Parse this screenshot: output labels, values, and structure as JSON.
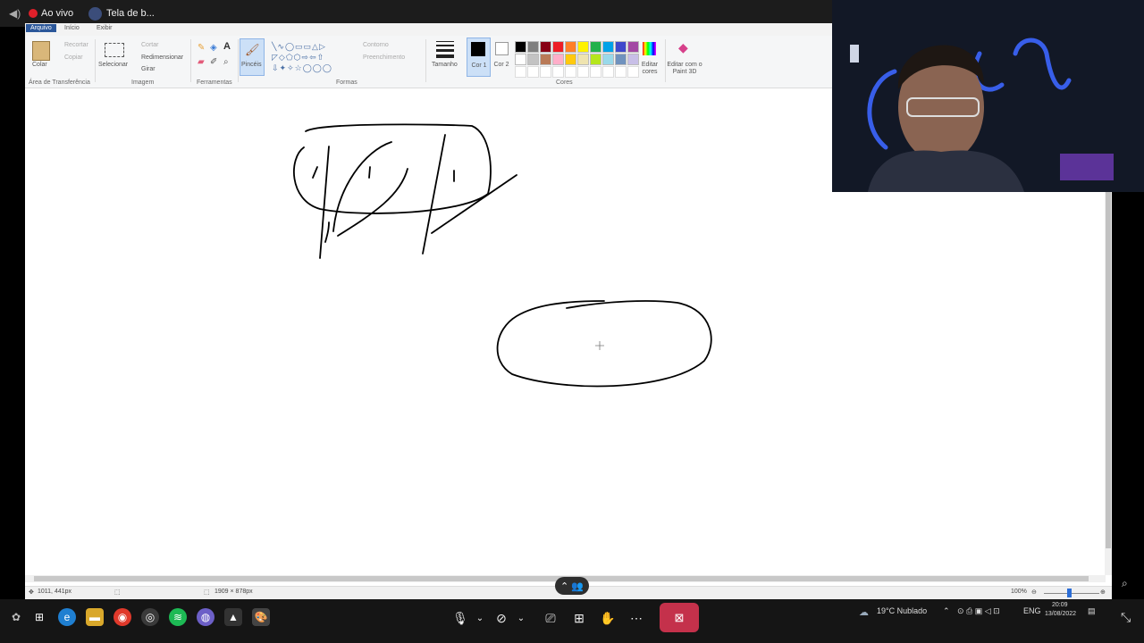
{
  "meeting": {
    "live_label": "Ao vivo",
    "share_label": "Tela de b..."
  },
  "paint": {
    "menus": [
      "Arquivo",
      "Início",
      "Exibir"
    ],
    "clipboard": {
      "paste": "Colar",
      "cut": "Recortar",
      "copy": "Copiar",
      "group": "Área de Transferência"
    },
    "image": {
      "select": "Selecionar",
      "crop": "Cortar",
      "resize": "Redimensionar",
      "rotate": "Girar",
      "group": "Imagem"
    },
    "tools": {
      "group": "Ferramentas"
    },
    "brushes": "Pincéis",
    "shapes": {
      "outline": "Contorno",
      "fill": "Preenchimento",
      "group": "Formas"
    },
    "size": "Tamanho",
    "color1": "Cor 1",
    "color2": "Cor 2",
    "colors_group": "Cores",
    "edit_colors": "Editar cores",
    "edit_paint3d": "Editar com o Paint 3D",
    "palette_row1": [
      "#000000",
      "#7f7f7f",
      "#880015",
      "#ed1c24",
      "#ff7f27",
      "#fff200",
      "#22b14c",
      "#00a2e8",
      "#3f48cc",
      "#a349a4"
    ],
    "palette_row2": [
      "#ffffff",
      "#c3c3c3",
      "#b97a57",
      "#ffaec9",
      "#ffc90e",
      "#efe4b0",
      "#b5e61d",
      "#99d9ea",
      "#7092be",
      "#c8bfe7"
    ],
    "status": {
      "cursor_pos": "1011, 441px",
      "canvas_size": "1909 × 878px",
      "zoom": "100%"
    }
  },
  "taskbar": {
    "weather": "19°C  Nublado",
    "lang": "ENG",
    "time": "20:09",
    "date": "13/08/2022"
  }
}
